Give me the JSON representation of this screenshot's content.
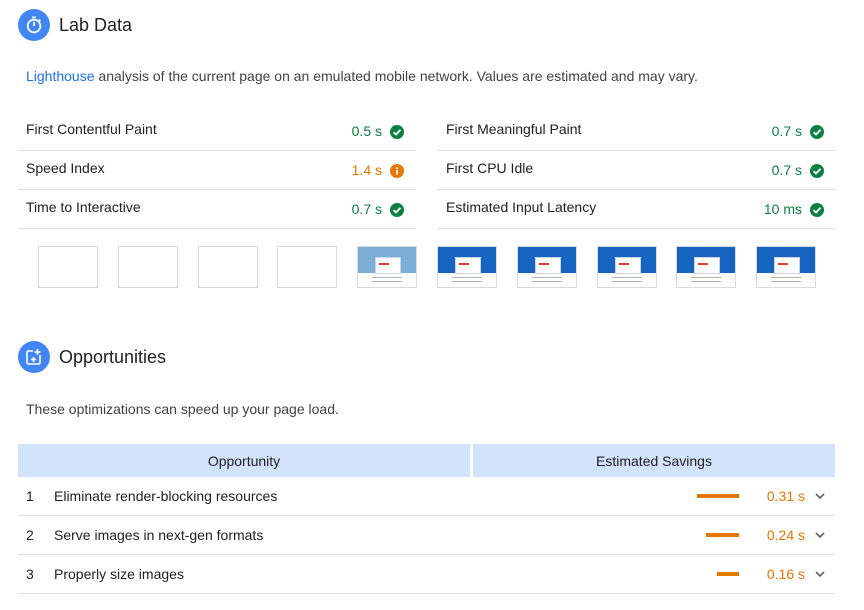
{
  "lab": {
    "title": "Lab Data",
    "icon": "stopwatch-icon",
    "description_link": "Lighthouse",
    "description_rest": " analysis of the current page on an emulated mobile network. Values are estimated and may vary.",
    "metrics_left": [
      {
        "label": "First Contentful Paint",
        "value": "0.5 s",
        "status": "pass"
      },
      {
        "label": "Speed Index",
        "value": "1.4 s",
        "status": "average"
      },
      {
        "label": "Time to Interactive",
        "value": "0.7 s",
        "status": "pass"
      }
    ],
    "metrics_right": [
      {
        "label": "First Meaningful Paint",
        "value": "0.7 s",
        "status": "pass"
      },
      {
        "label": "First CPU Idle",
        "value": "0.7 s",
        "status": "pass"
      },
      {
        "label": "Estimated Input Latency",
        "value": "10 ms",
        "status": "pass"
      }
    ],
    "filmstrip": [
      "blank",
      "blank",
      "blank",
      "blank",
      "loading",
      "loaded",
      "loaded",
      "loaded",
      "loaded",
      "loaded"
    ]
  },
  "opportunities": {
    "title": "Opportunities",
    "icon": "opportunity-icon",
    "description": "These optimizations can speed up your page load.",
    "header_opportunity": "Opportunity",
    "header_savings": "Estimated Savings",
    "items": [
      {
        "num": "1",
        "name": "Eliminate render-blocking resources",
        "savings": "0.31 s",
        "fraction": 0.31
      },
      {
        "num": "2",
        "name": "Serve images in next-gen formats",
        "savings": "0.24 s",
        "fraction": 0.24
      },
      {
        "num": "3",
        "name": "Properly size images",
        "savings": "0.16 s",
        "fraction": 0.16
      }
    ]
  },
  "colors": {
    "accent": "#4285f4",
    "pass": "#0b8043",
    "average": "#e67700",
    "header_bg": "#d2e3fc"
  }
}
